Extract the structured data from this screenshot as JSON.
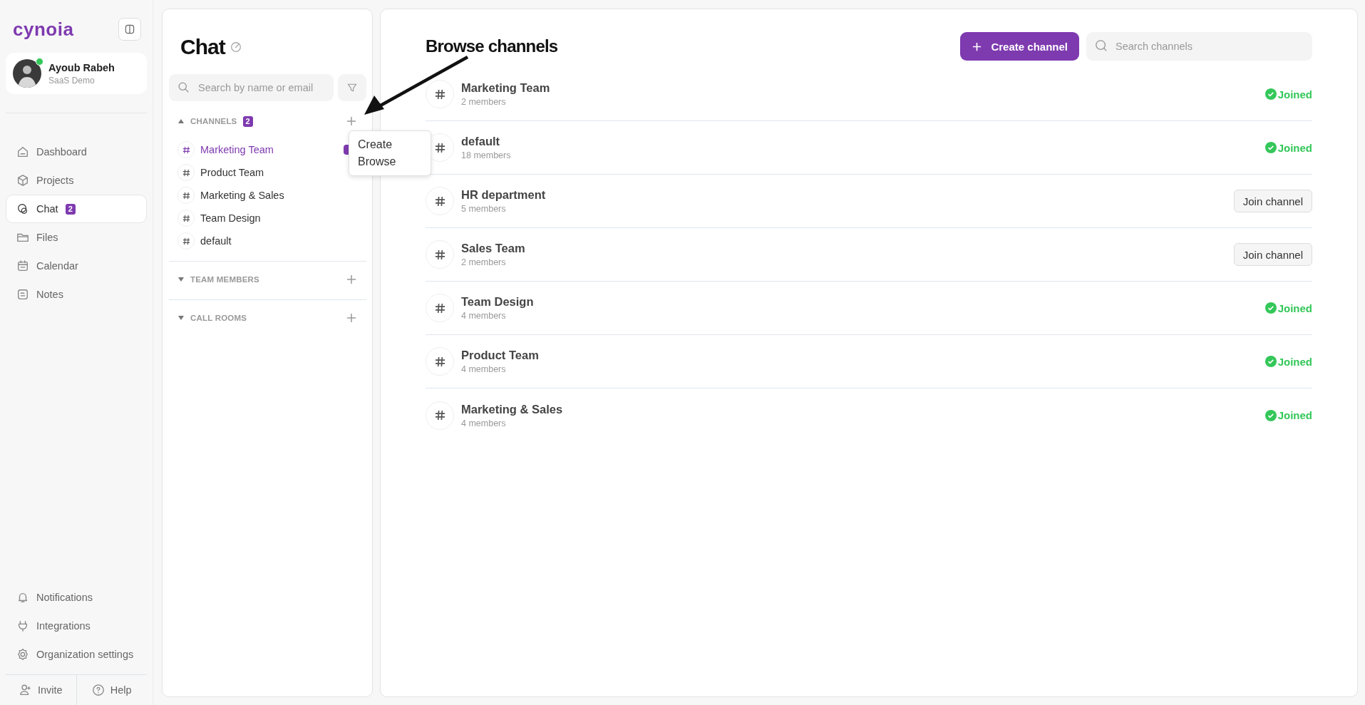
{
  "sidebar": {
    "logo": "cynoia",
    "profile": {
      "name": "Ayoub Rabeh",
      "subtitle": "SaaS Demo",
      "online": true
    },
    "nav": [
      {
        "label": "Dashboard",
        "selected": false
      },
      {
        "label": "Projects",
        "selected": false
      },
      {
        "label": "Chat",
        "selected": true,
        "badge": "2"
      },
      {
        "label": "Files",
        "selected": false
      },
      {
        "label": "Calendar",
        "selected": false
      },
      {
        "label": "Notes",
        "selected": false
      }
    ],
    "bottom_nav": [
      {
        "label": "Notifications"
      },
      {
        "label": "Integrations"
      },
      {
        "label": "Organization settings"
      }
    ],
    "footer": [
      {
        "label": "Invite"
      },
      {
        "label": "Help"
      }
    ]
  },
  "chat_panel": {
    "title": "Chat",
    "search": {
      "placeholder": "Search by name or email"
    },
    "sections": [
      {
        "label": "CHANNELS",
        "expanded": true,
        "badge": "2",
        "items": [
          {
            "name": "Marketing Team",
            "selected": true,
            "unread": true
          },
          {
            "name": "Product Team",
            "selected": false,
            "unread": false
          },
          {
            "name": "Marketing & Sales",
            "selected": false,
            "unread": false
          },
          {
            "name": "Team Design",
            "selected": false,
            "unread": false
          },
          {
            "name": "default",
            "selected": false,
            "unread": false
          }
        ]
      },
      {
        "label": "TEAM MEMBERS",
        "expanded": false
      },
      {
        "label": "CALL ROOMS",
        "expanded": false
      }
    ],
    "menu": [
      "Create",
      "Browse"
    ]
  },
  "browse": {
    "title": "Browse channels",
    "create_button": "Create channel",
    "search": {
      "placeholder": "Search channels"
    },
    "channels": [
      {
        "name": "Marketing Team",
        "members": "2 members",
        "kind": "joined",
        "status": "Joined"
      },
      {
        "name": "default",
        "members": "18 members",
        "kind": "joined",
        "status": "Joined"
      },
      {
        "name": "HR department",
        "members": "5 members",
        "kind": "join",
        "status": "Join channel"
      },
      {
        "name": "Sales Team",
        "members": "2 members",
        "kind": "join",
        "status": "Join channel"
      },
      {
        "name": "Team Design",
        "members": "4 members",
        "kind": "joined",
        "status": "Joined"
      },
      {
        "name": "Product Team",
        "members": "4 members",
        "kind": "joined",
        "status": "Joined"
      },
      {
        "name": "Marketing & Sales",
        "members": "4 members",
        "kind": "joined",
        "status": "Joined"
      }
    ]
  },
  "annotation": {
    "kind": "arrow"
  }
}
